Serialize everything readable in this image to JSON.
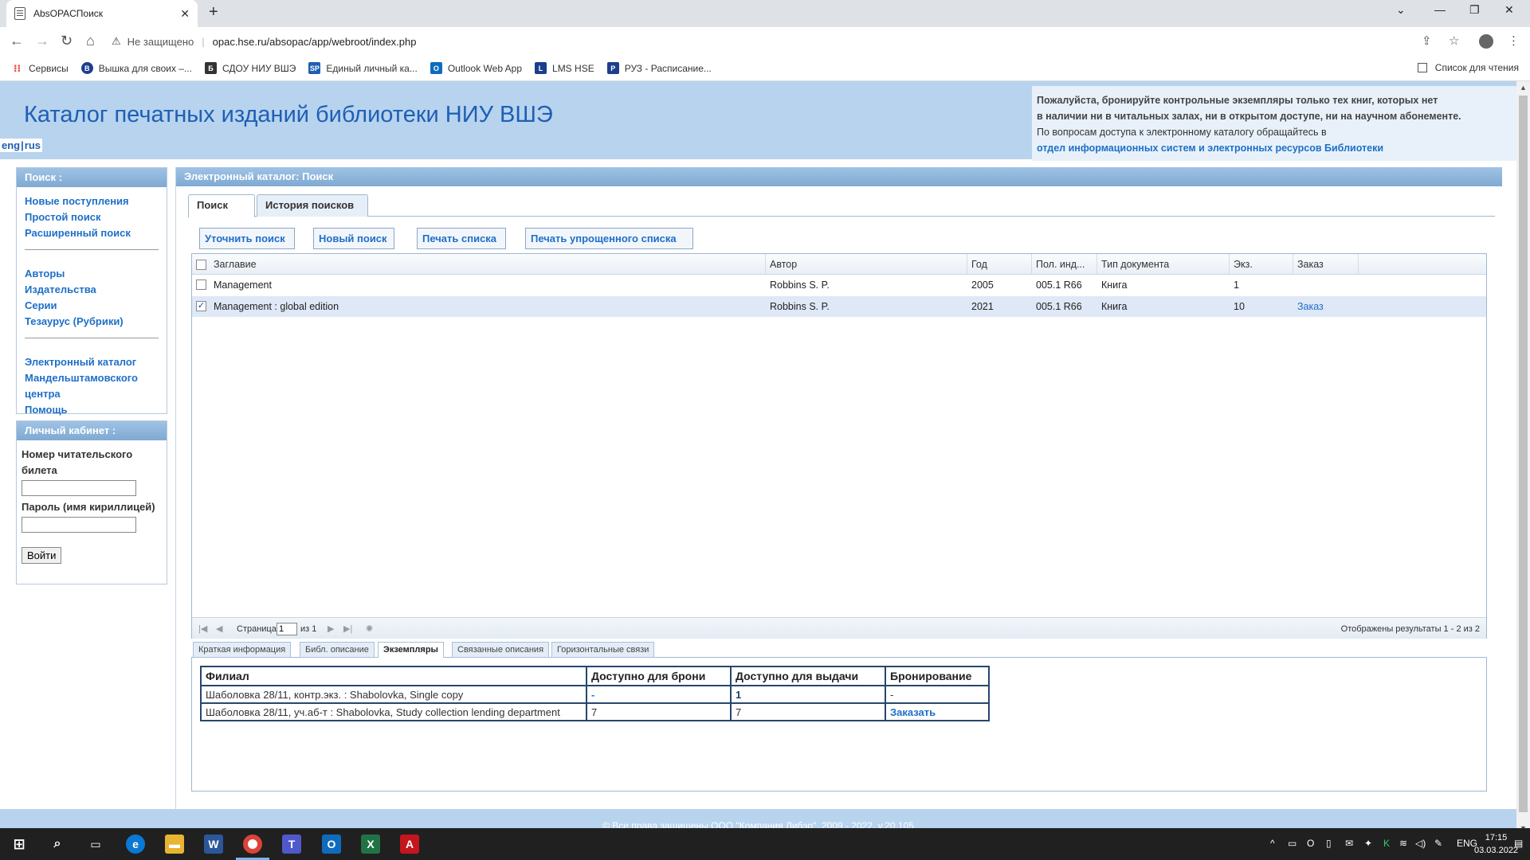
{
  "browser": {
    "tab_title": "AbsOPACПоиск",
    "tab_close": "✕",
    "new_tab": "+",
    "omnibox": {
      "security_label": "Не защищено",
      "url": "opac.hse.ru/absopac/app/webroot/index.php"
    },
    "bookmarks": [
      {
        "label": "Сервисы",
        "icon": "apps-grid-icon",
        "color": "#ea4335"
      },
      {
        "label": "Вышка для своих –...",
        "icon": "hse-logo-icon",
        "color": "#1c3f8c"
      },
      {
        "label": "СДОУ НИУ ВШЭ",
        "icon": "doc-icon",
        "color": "#333333"
      },
      {
        "label": "Единый личный ка...",
        "icon": "sp-icon",
        "color": "#1e5fb3"
      },
      {
        "label": "Outlook Web App",
        "icon": "outlook-icon",
        "color": "#0f6cbd"
      },
      {
        "label": "LMS HSE",
        "icon": "lms-icon",
        "color": "#1c3f8c"
      },
      {
        "label": "РУЗ - Расписание...",
        "icon": "ruz-icon",
        "color": "#1c3f8c"
      }
    ],
    "reading_list": "Список для чтения"
  },
  "header": {
    "title": "Каталог печатных изданий библиотеки НИУ ВШЭ",
    "lang_eng": "eng",
    "lang_rus": "rus",
    "notice_line1": "Пожалуйста, бронируйте контрольные экземпляры только тех книг, которых нет",
    "notice_line2": "в наличии ни в читальных залах, ни в открытом доступе, ни на научном абонементе.",
    "notice_line3": "По вопросам доступа к электронному каталогу обращайтесь в",
    "notice_link": "отдел информационных систем и электронных ресурсов Библиотеки"
  },
  "sidebar": {
    "search_title": "Поиск :",
    "group1": [
      "Новые поступления",
      "Простой поиск",
      "Расширенный поиск"
    ],
    "group2": [
      "Авторы",
      "Издательства",
      "Серии",
      "Тезаурус (Рубрики)"
    ],
    "group3": [
      "Электронный каталог Мандельштамовского центра",
      "Помощь"
    ],
    "cabinet_title": "Личный кабинет :",
    "ticket_label": "Номер читательского билета",
    "password_label": "Пароль (имя кириллицей)",
    "login_button": "Войти"
  },
  "main": {
    "title": "Электронный каталог: Поиск",
    "tabs": [
      "Поиск",
      "История поисков"
    ],
    "buttons": [
      "Уточнить поиск",
      "Новый поиск",
      "Печать списка",
      "Печать упрощенного списка"
    ],
    "columns": [
      "Заглавие",
      "Автор",
      "Год",
      "Пол. инд...",
      "Тип документа",
      "Экз.",
      "Заказ"
    ],
    "rows": [
      {
        "title": "Management",
        "author": "Robbins S. P.",
        "year": "2005",
        "index": "005.1 R66",
        "type": "Книга",
        "copies": "1",
        "order": "",
        "checked": false
      },
      {
        "title": "Management : global edition",
        "author": "Robbins S. P.",
        "year": "2021",
        "index": "005.1 R66",
        "type": "Книга",
        "copies": "10",
        "order": "Заказ",
        "checked": true
      }
    ],
    "pager": {
      "page_label": "Страница",
      "page_value": "1",
      "of_label": "из 1",
      "summary": "Отображены результаты 1 - 2 из 2"
    },
    "subtabs": [
      "Краткая информация",
      "Библ. описание",
      "Экземпляры",
      "Связанные описания",
      "Горизонтальные связи"
    ],
    "copies_table": {
      "headers": [
        "Филиал",
        "Доступно для брони",
        "Доступно для выдачи",
        "Бронирование"
      ],
      "rows": [
        [
          "Шаболовка 28/11, контр.экз. : Shabolovka, Single copy",
          "-",
          "1",
          "-"
        ],
        [
          "Шаболовка 28/11, уч.аб-т : Shabolovka, Study collection lending department",
          "7",
          "7",
          "Заказать"
        ]
      ]
    }
  },
  "footer": {
    "text": "© Все права защищены ООО \"Компания Либэр\", 2009 - 2022, v.20.105"
  },
  "taskbar": {
    "lang": "ENG",
    "time": "17:15",
    "date": "03.03.2022"
  }
}
